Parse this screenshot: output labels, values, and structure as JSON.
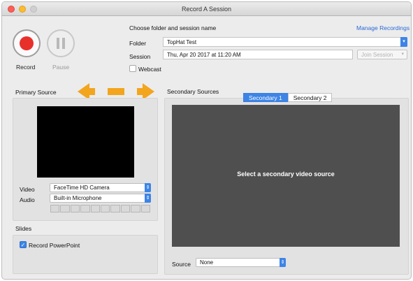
{
  "window": {
    "title": "Record A Session"
  },
  "controls": {
    "record_label": "Record",
    "pause_label": "Pause"
  },
  "session": {
    "header": "Choose folder and session name",
    "manage_link": "Manage Recordings",
    "folder_label": "Folder",
    "folder_value": "TopHat Test",
    "session_label": "Session",
    "session_value": "Thu, Apr 20 2017 at 11:20 AM",
    "join_button": "Join Session",
    "webcast_label": "Webcast",
    "webcast_checked": false
  },
  "primary": {
    "title": "Primary Source",
    "video_label": "Video",
    "video_value": "FaceTime HD Camera",
    "audio_label": "Audio",
    "audio_value": "Built-in Microphone",
    "audio_meter_level": 0
  },
  "slides": {
    "title": "Slides",
    "record_ppt_label": "Record PowerPoint",
    "record_ppt_checked": true
  },
  "secondary": {
    "title": "Secondary Sources",
    "tabs": [
      {
        "label": "Secondary 1",
        "active": true
      },
      {
        "label": "Secondary 2",
        "active": false
      }
    ],
    "message": "Select a secondary video source",
    "source_label": "Source",
    "source_value": "None"
  },
  "colors": {
    "accent": "#3d84e6",
    "record_red": "#e8302b",
    "arrow_orange": "#f3a51e",
    "link": "#2a69d6"
  },
  "icons": {
    "record": "record-circle-icon",
    "pause": "pause-bars-icon",
    "select": "chevron-updown-icon",
    "arrow": "double-headed-arrow-icon"
  }
}
